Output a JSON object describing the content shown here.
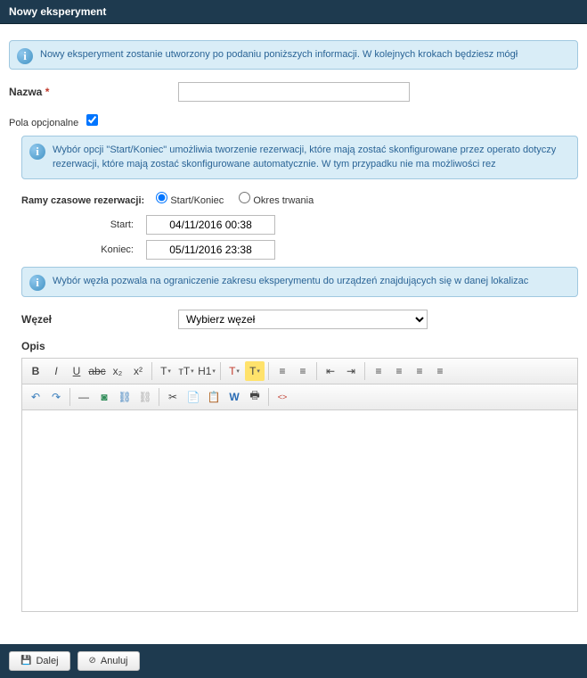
{
  "header": {
    "title": "Nowy eksperyment"
  },
  "info1": "Nowy eksperyment zostanie utworzony po podaniu poniższych informacji. W kolejnych krokach będziesz mógł",
  "name": {
    "label": "Nazwa",
    "required": "*",
    "value": ""
  },
  "optional": {
    "label": "Pola opcjonalne",
    "checked": true
  },
  "info2": "Wybór opcji \"Start/Koniec\" umożliwia tworzenie rezerwacji, które mają zostać skonfigurowane przez operato dotyczy rezerwacji, które mają zostać skonfigurowane automatycznie. W tym przypadku nie ma możliwości rez",
  "ramy": {
    "label": "Ramy czasowe rezerwacji:",
    "opt_start": "Start/Koniec",
    "opt_duration": "Okres trwania"
  },
  "start": {
    "label": "Start:",
    "value": "04/11/2016 00:38"
  },
  "koniec": {
    "label": "Koniec:",
    "value": "05/11/2016 23:38"
  },
  "info3": "Wybór węzła pozwala na ograniczenie zakresu eksperymentu do urządzeń znajdujących się w danej lokalizac",
  "wezel": {
    "label": "Węzeł",
    "selected": "Wybierz węzeł"
  },
  "opis": {
    "label": "Opis"
  },
  "footer": {
    "next": "Dalej",
    "cancel": "Anuluj"
  },
  "toolbar": {
    "bold": "B",
    "italic": "I",
    "underline": "U",
    "strike": "abc",
    "sub": "x₂",
    "sup": "x²",
    "fontsize": "T",
    "fontface": "тT",
    "heading": "H1",
    "color": "T",
    "hilite": "T",
    "ol": "≡",
    "ul": "≡",
    "indent": "⇥",
    "outdent": "⇤",
    "left": "≡",
    "center": "≡",
    "right": "≡",
    "justify": "≡",
    "undo": "↶",
    "redo": "↷",
    "hr": "—",
    "img": "◙",
    "link": "⛓",
    "unlink": "⛓",
    "cut": "✂",
    "copy": "📄",
    "paste": "📋",
    "pasteword": "W",
    "print": "🖶",
    "source": "<>"
  }
}
